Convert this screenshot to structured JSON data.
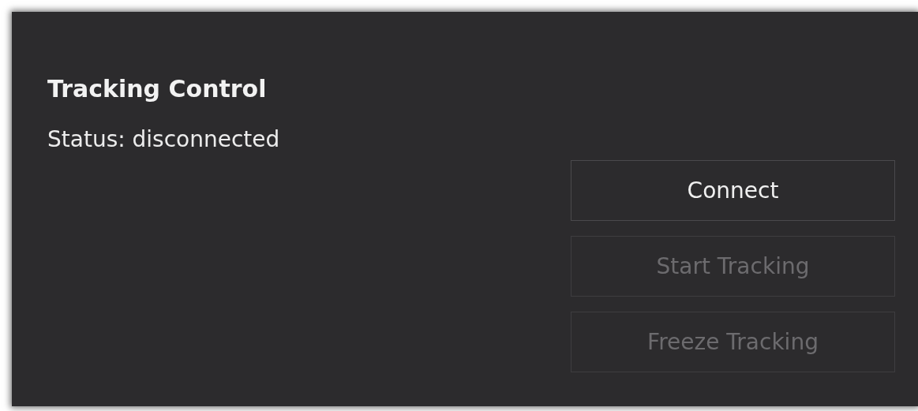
{
  "panel": {
    "title": "Tracking Control",
    "status": "Status: disconnected"
  },
  "buttons": [
    {
      "label": "Connect",
      "disabled": false
    },
    {
      "label": "Start Tracking",
      "disabled": true
    },
    {
      "label": "Freeze Tracking",
      "disabled": true
    }
  ]
}
